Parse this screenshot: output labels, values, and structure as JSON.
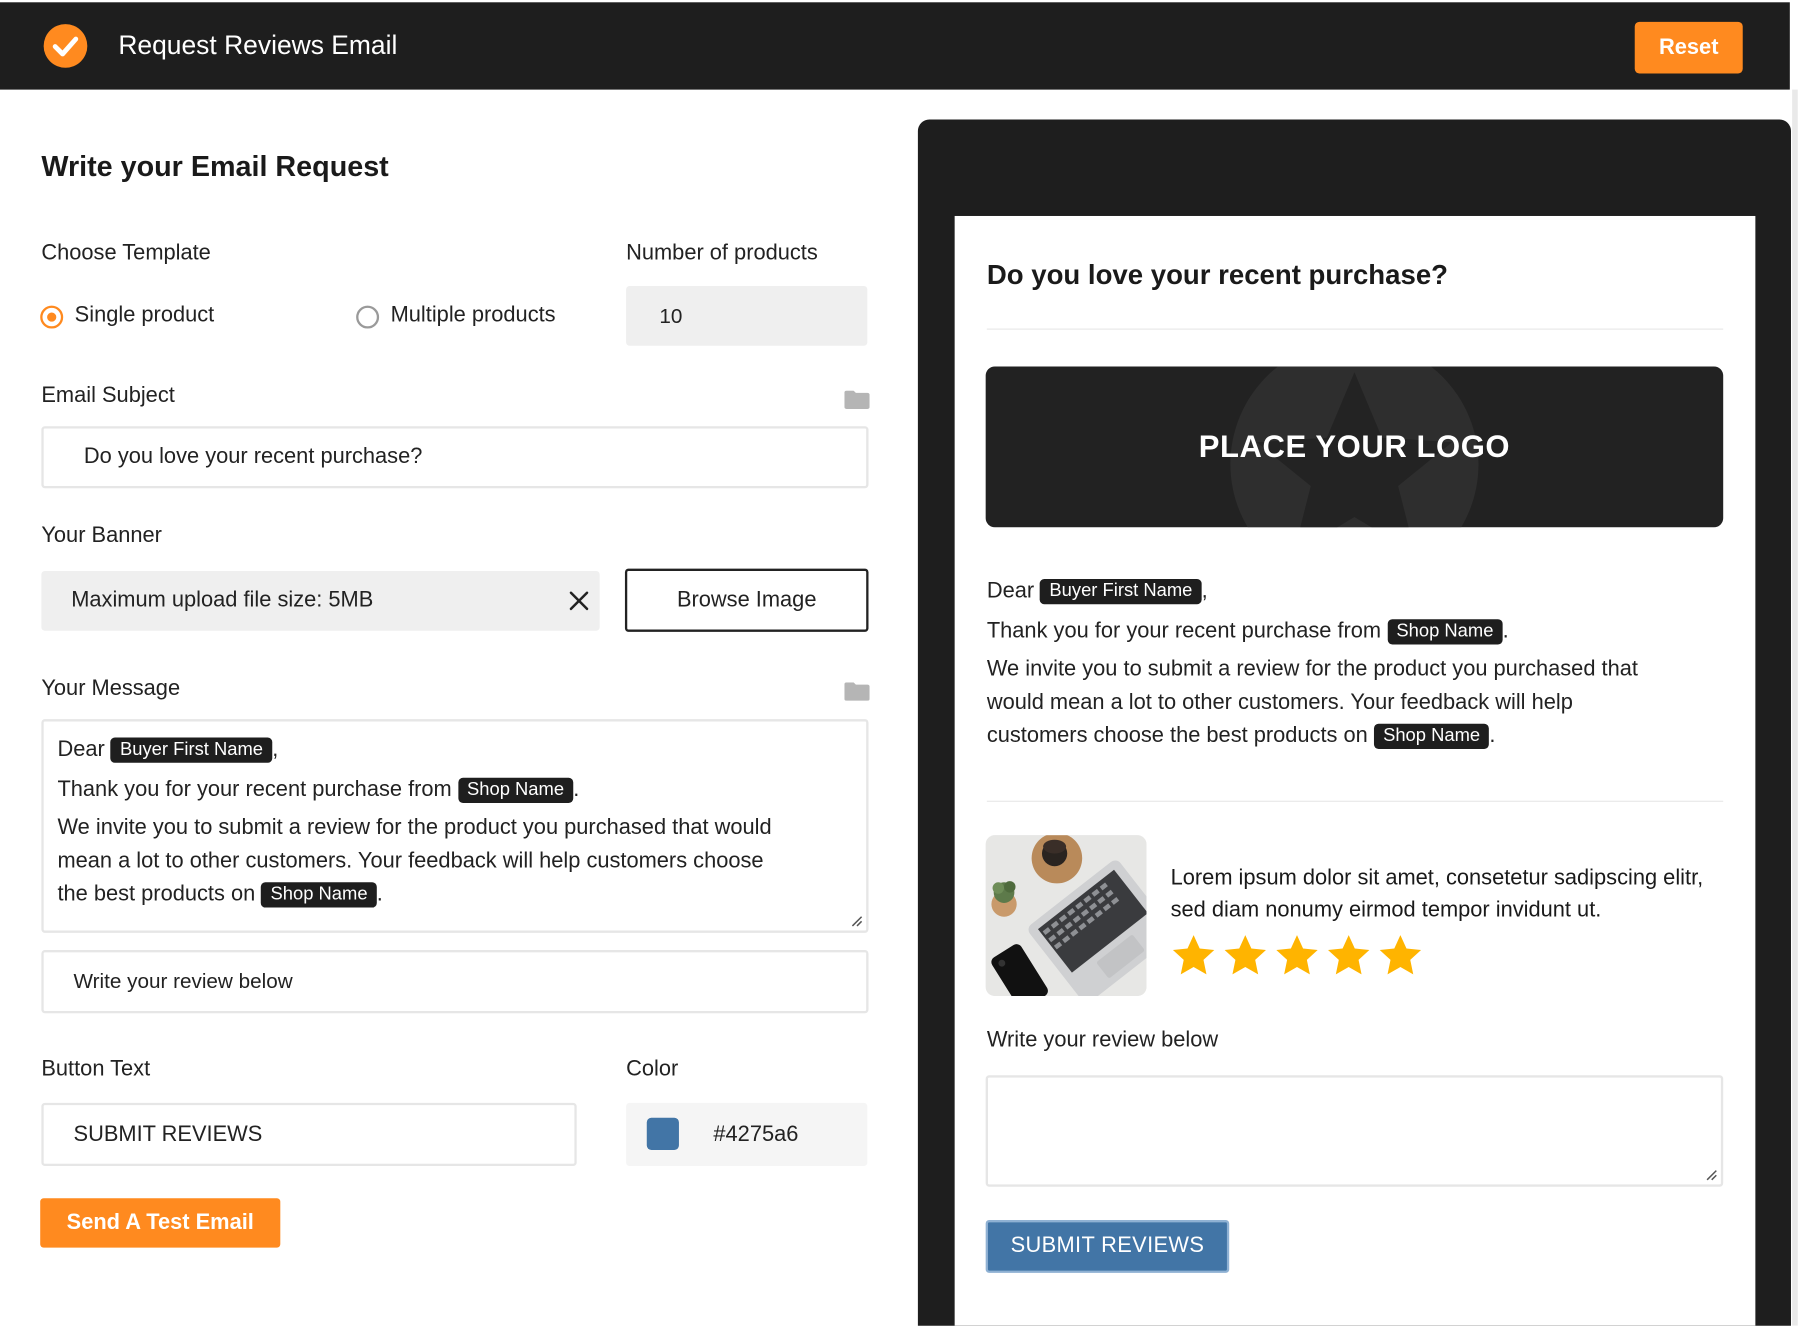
{
  "header": {
    "title": "Request Reviews Email",
    "reset_label": "Reset",
    "brand_icon": "check-circle-icon",
    "accent_color": "#ff8a1f"
  },
  "form": {
    "title": "Write your Email Request",
    "template_label": "Choose Template",
    "template_options": [
      {
        "label": "Single product",
        "selected": true
      },
      {
        "label": "Multiple products",
        "selected": false
      }
    ],
    "num_products_label": "Number of products",
    "num_products_value": "10",
    "subject_label": "Email Subject",
    "subject_value": "Do you love your recent purchase?",
    "banner_label": "Your Banner",
    "banner_hint": "Maximum upload file size: 5MB",
    "browse_label": "Browse Image",
    "message_label": "Your Message",
    "message": {
      "dear": "Dear",
      "buyer_tag": "Buyer First Name",
      "comma": ",",
      "thanks": "Thank you for your recent purchase from",
      "shop_tag": "Shop Name",
      "period": ".",
      "invite_1": "We invite you to submit a review for the product you purchased that would",
      "invite_2": "mean a lot to other customers. Your feedback will help customers choose",
      "invite_3": "the best products on"
    },
    "review_prompt_value": "Write your review below",
    "button_text_label": "Button Text",
    "button_text_value": "SUBMIT REVIEWS",
    "color_label": "Color",
    "color_value": "#4275a6",
    "test_email_label": "Send A Test Email"
  },
  "preview": {
    "heading": "Do you love your recent purchase?",
    "logo_placeholder": "PLACE YOUR LOGO",
    "message": {
      "dear": "Dear",
      "buyer_tag": "Buyer First Name",
      "comma": ",",
      "thanks": "Thank you for your recent purchase from",
      "shop_tag": "Shop Name",
      "period": ".",
      "invite_1": "We invite you to submit a review for the product you purchased that",
      "invite_2": "would mean a lot to other customers. Your feedback will help",
      "invite_3": "customers choose the best products on"
    },
    "product_desc": "Lorem ipsum dolor sit amet, consetetur sadipscing elitr, sed diam nonumy eirmod tempor invidunt ut.",
    "rating": 5,
    "rating_max": 5,
    "star_color": "#ffb400",
    "review_label": "Write your review below",
    "submit_label": "SUBMIT REVIEWS",
    "submit_color": "#4275a6"
  }
}
